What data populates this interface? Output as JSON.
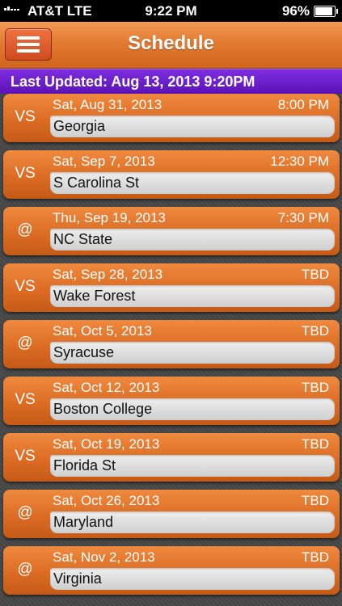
{
  "status_bar": {
    "carrier": "AT&T  LTE",
    "time": "9:22 PM",
    "battery": "96%"
  },
  "nav": {
    "title": "Schedule",
    "menu_icon": "hamburger-menu-icon"
  },
  "last_updated": "Last Updated: Aug 13, 2013 9:20PM",
  "colors": {
    "accent_orange": "#e27a30",
    "updated_bar_purple": "#6a1fcc",
    "background": "#474747"
  },
  "games": [
    {
      "type": "VS",
      "date": "Sat, Aug 31, 2013",
      "time": "8:00 PM",
      "opponent": "Georgia"
    },
    {
      "type": "VS",
      "date": "Sat, Sep 7, 2013",
      "time": "12:30 PM",
      "opponent": "S Carolina St"
    },
    {
      "type": "@",
      "date": "Thu, Sep 19, 2013",
      "time": "7:30 PM",
      "opponent": "NC State"
    },
    {
      "type": "VS",
      "date": "Sat, Sep 28, 2013",
      "time": "TBD",
      "opponent": "Wake Forest"
    },
    {
      "type": "@",
      "date": "Sat, Oct 5, 2013",
      "time": "TBD",
      "opponent": "Syracuse"
    },
    {
      "type": "VS",
      "date": "Sat, Oct 12, 2013",
      "time": "TBD",
      "opponent": "Boston College"
    },
    {
      "type": "VS",
      "date": "Sat, Oct 19, 2013",
      "time": "TBD",
      "opponent": "Florida St"
    },
    {
      "type": "@",
      "date": "Sat, Oct 26, 2013",
      "time": "TBD",
      "opponent": "Maryland"
    },
    {
      "type": "@",
      "date": "Sat, Nov 2, 2013",
      "time": "TBD",
      "opponent": "Virginia"
    }
  ]
}
